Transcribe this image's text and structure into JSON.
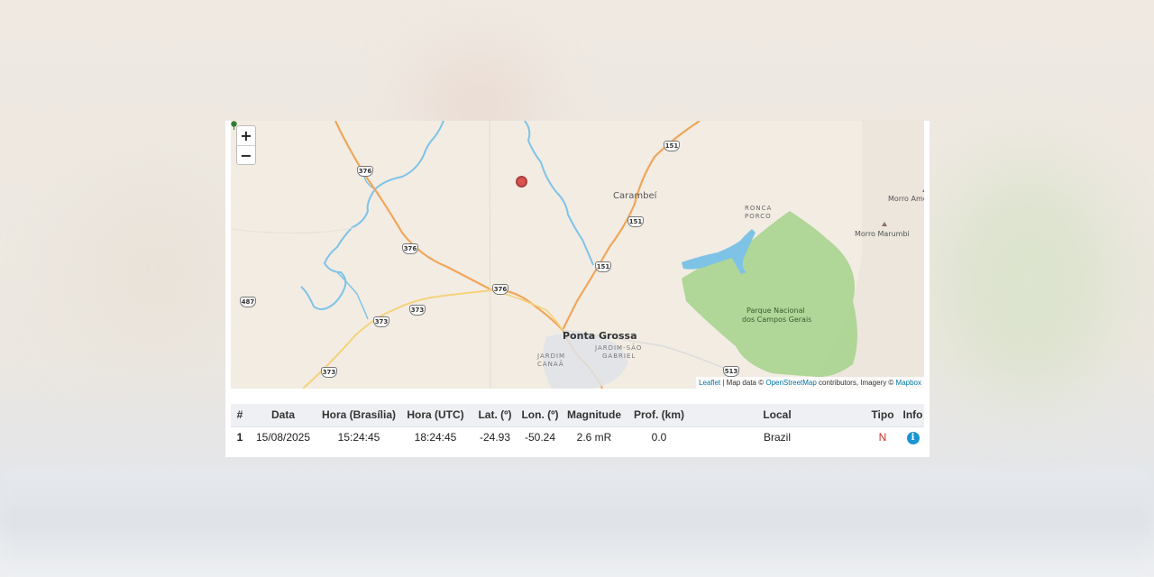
{
  "map": {
    "zoom_in": "+",
    "zoom_out": "−",
    "attribution": {
      "leaflet": "Leaflet",
      "mid": " | Map data © ",
      "osm": "OpenStreetMap",
      "contrib": " contributors, Imagery © ",
      "mapbox": "Mapbox"
    },
    "places": {
      "carambei": "Carambeí",
      "ronca": "RONCA",
      "porco": "PORCO",
      "morro_amelia": "Morro Amel",
      "morro_marumbi": "Morro Marumbi",
      "parque_1": "Parque Nacional",
      "parque_2": "dos Campos Gerais",
      "ponta_grossa": "Ponta Grossa",
      "jardim_canaa_1": "JARDIM",
      "jardim_canaa_2": "CANAÃ",
      "jardim_sg_1": "JARDIM-SÃO",
      "jardim_sg_2": "GABRIEL"
    },
    "shields": {
      "s376a": "376",
      "s376b": "376",
      "s376c": "376",
      "s151a": "151",
      "s151b": "151",
      "s151c": "151",
      "s487": "487",
      "s373a": "373",
      "s373b": "373",
      "s373c": "373",
      "s513": "513"
    },
    "marker_icon": "earthquake-marker",
    "colors": {
      "water": "#7ec3e6",
      "park": "#a9d48f",
      "road": "#f0a65a",
      "marker": "#d9534f"
    }
  },
  "table": {
    "headers": {
      "num": "#",
      "data": "Data",
      "hora_brasilia": "Hora (Brasília)",
      "hora_utc": "Hora (UTC)",
      "lat": "Lat. (º)",
      "lon": "Lon. (º)",
      "magnitude": "Magnitude",
      "prof": "Prof. (km)",
      "local": "Local",
      "tipo": "Tipo",
      "info": "Info"
    },
    "rows": [
      {
        "num": "1",
        "data": "15/08/2025",
        "hora_brasilia": "15:24:45",
        "hora_utc": "18:24:45",
        "lat": "-24.93",
        "lon": "-50.24",
        "magnitude": "2.6 mR",
        "prof": "0.0",
        "local": "Brazil",
        "tipo": "N",
        "info_icon": "i"
      }
    ]
  }
}
